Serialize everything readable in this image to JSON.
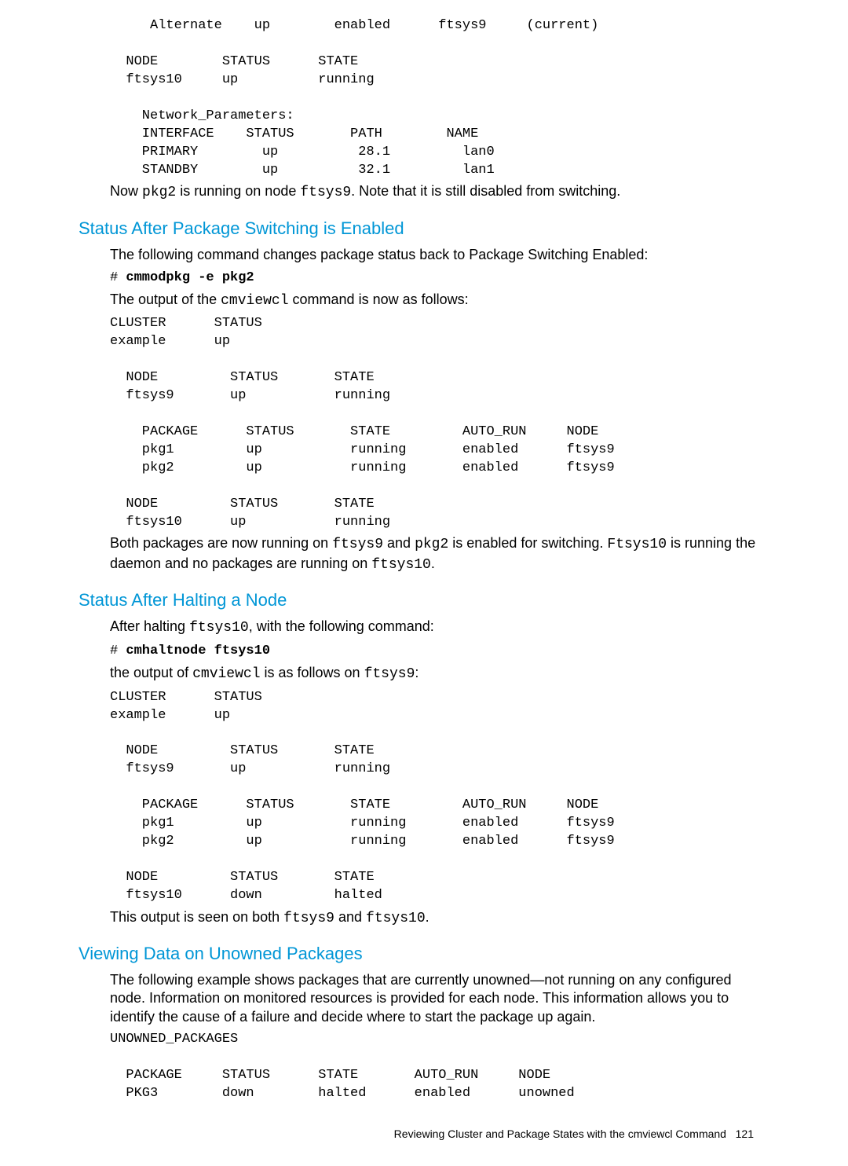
{
  "block1": "     Alternate    up        enabled      ftsys9     (current)\n\n  NODE        STATUS      STATE\n  ftsys10     up          running\n\n    Network_Parameters:\n    INTERFACE    STATUS       PATH        NAME\n    PRIMARY        up          28.1         lan0\n    STANDBY        up          32.1         lan1",
  "para1_a": "Now ",
  "para1_b": "pkg2",
  "para1_c": " is running on node ",
  "para1_d": "ftsys9",
  "para1_e": ". Note that it is still disabled from switching.",
  "heading1": "Status After Package Switching is Enabled",
  "para2": "The following command changes package status back to Package Switching Enabled:",
  "cmd1_a": "# ",
  "cmd1_b": "cmmodpkg -e pkg2",
  "para3_a": "The output of the ",
  "para3_b": "cmviewcl",
  "para3_c": " command is now as follows:",
  "block2": "CLUSTER      STATUS\nexample      up\n\n  NODE         STATUS       STATE\n  ftsys9       up           running\n\n    PACKAGE      STATUS       STATE         AUTO_RUN     NODE\n    pkg1         up           running       enabled      ftsys9\n    pkg2         up           running       enabled      ftsys9\n\n  NODE         STATUS       STATE\n  ftsys10      up           running",
  "para4_a": "Both packages are now running on ",
  "para4_b": "ftsys9",
  "para4_c": " and ",
  "para4_d": "pkg2",
  "para4_e": " is enabled for switching. ",
  "para4_f": "Ftsys10",
  "para4_g": " is running the daemon and no packages are running on ",
  "para4_h": "ftsys10",
  "para4_i": ".",
  "heading2": "Status After Halting a Node",
  "para5_a": "After halting ",
  "para5_b": "ftsys10",
  "para5_c": ", with the following command:",
  "cmd2_a": "# ",
  "cmd2_b": "cmhaltnode  ftsys10",
  "para6_a": "the output of ",
  "para6_b": "cmviewcl",
  "para6_c": " is as follows on ",
  "para6_d": "ftsys9",
  "para6_e": ":",
  "block3": "CLUSTER      STATUS\nexample      up\n\n  NODE         STATUS       STATE\n  ftsys9       up           running\n\n    PACKAGE      STATUS       STATE         AUTO_RUN     NODE\n    pkg1         up           running       enabled      ftsys9\n    pkg2         up           running       enabled      ftsys9\n\n  NODE         STATUS       STATE\n  ftsys10      down         halted",
  "para7_a": "This output is seen on both ",
  "para7_b": "ftsys9",
  "para7_c": " and ",
  "para7_d": "ftsys10",
  "para7_e": ".",
  "heading3": "Viewing Data on Unowned Packages",
  "para8": "The following example shows packages that are currently unowned—not running on any configured node. Information on monitored resources is provided for each node. This information allows you to identify the cause of a failure and decide where to start the package up again.",
  "block4": "UNOWNED_PACKAGES\n\n  PACKAGE     STATUS      STATE       AUTO_RUN     NODE\n  PKG3        down        halted      enabled      unowned",
  "footer_text": "Reviewing Cluster and Package States with the cmviewcl Command",
  "footer_page": "121"
}
